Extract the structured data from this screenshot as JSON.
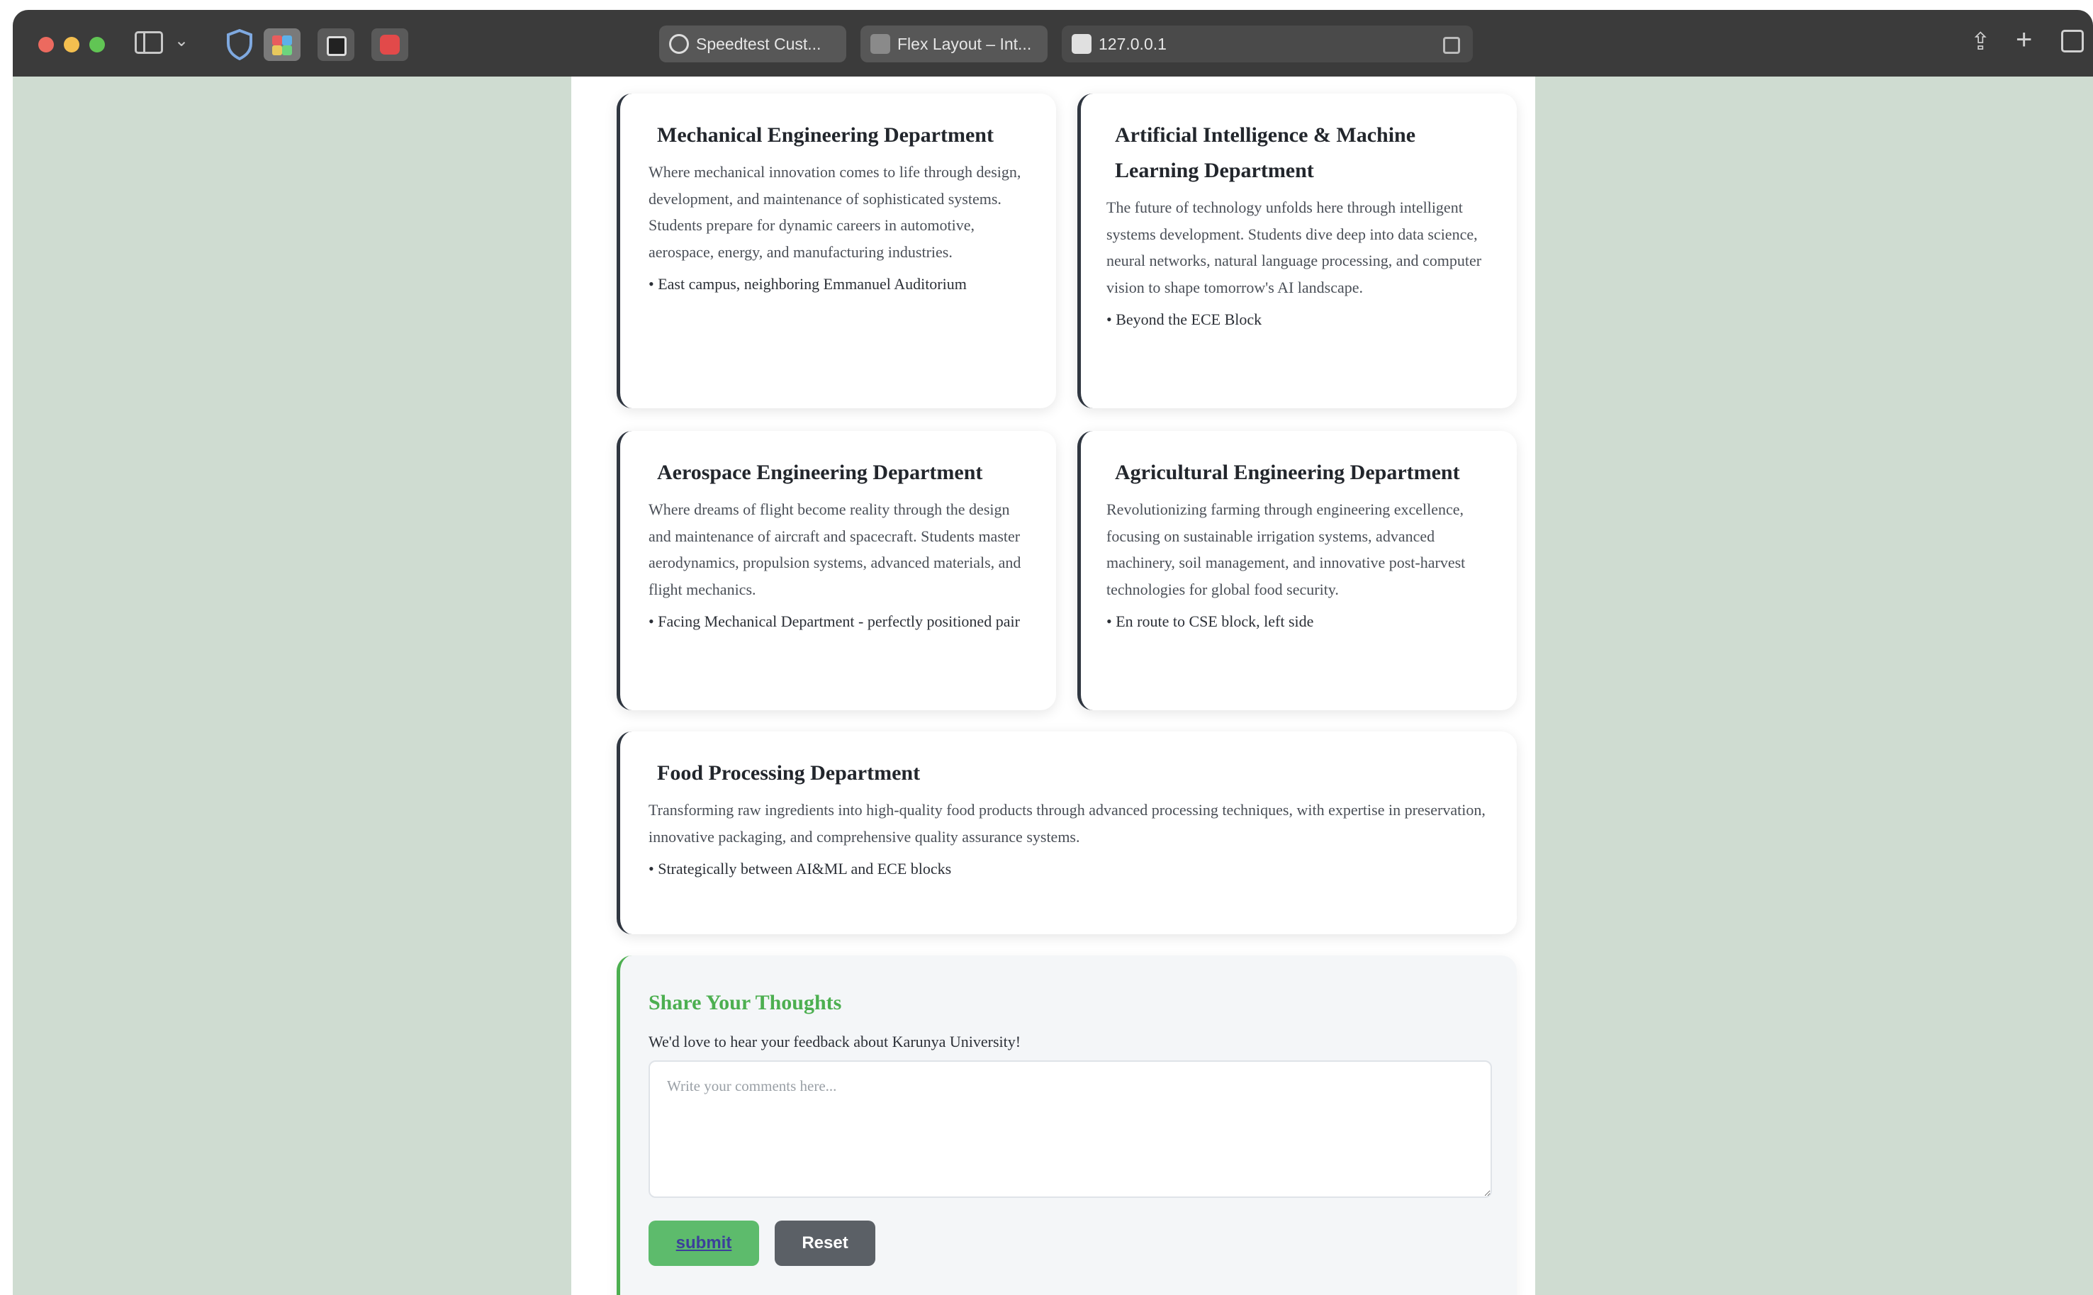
{
  "browser": {
    "tabs": [
      {
        "label": "Speedtest Cust..."
      },
      {
        "label": "Flex Layout – Int..."
      },
      {
        "label": "127.0.0.1"
      }
    ]
  },
  "departments": [
    {
      "title": "Mechanical Engineering Department",
      "description": "Where mechanical innovation comes to life through design, development, and maintenance of sophisticated systems. Students prepare for dynamic careers in automotive, aerospace, energy, and manufacturing industries.",
      "location": "• East campus, neighboring Emmanuel Auditorium"
    },
    {
      "title": "Artificial Intelligence & Machine Learning Department",
      "description": "The future of technology unfolds here through intelligent systems development. Students dive deep into data science, neural networks, natural language processing, and computer vision to shape tomorrow's AI landscape.",
      "location": "• Beyond the ECE Block"
    },
    {
      "title": "Aerospace Engineering Department",
      "description": "Where dreams of flight become reality through the design and maintenance of aircraft and spacecraft. Students master aerodynamics, propulsion systems, advanced materials, and flight mechanics.",
      "location": "• Facing Mechanical Department - perfectly positioned pair"
    },
    {
      "title": "Agricultural Engineering Department",
      "description": "Revolutionizing farming through engineering excellence, focusing on sustainable irrigation systems, advanced machinery, soil management, and innovative post-harvest technologies for global food security.",
      "location": "• En route to CSE block, left side"
    },
    {
      "title": "Food Processing Department",
      "description": "Transforming raw ingredients into high-quality food products through advanced processing techniques, with expertise in preservation, innovative packaging, and comprehensive quality assurance systems.",
      "location": "• Strategically between AI&ML and ECE blocks"
    }
  ],
  "feedback": {
    "title": "Share Your Thoughts",
    "intro": "We'd love to hear your feedback about Karunya University!",
    "placeholder": "Write your comments here...",
    "value": "",
    "submit_label": "submit",
    "reset_label": "Reset"
  },
  "colors": {
    "accent_green": "#4caf50",
    "card_border": "#2f3640",
    "page_background": "#cfdcd1"
  }
}
